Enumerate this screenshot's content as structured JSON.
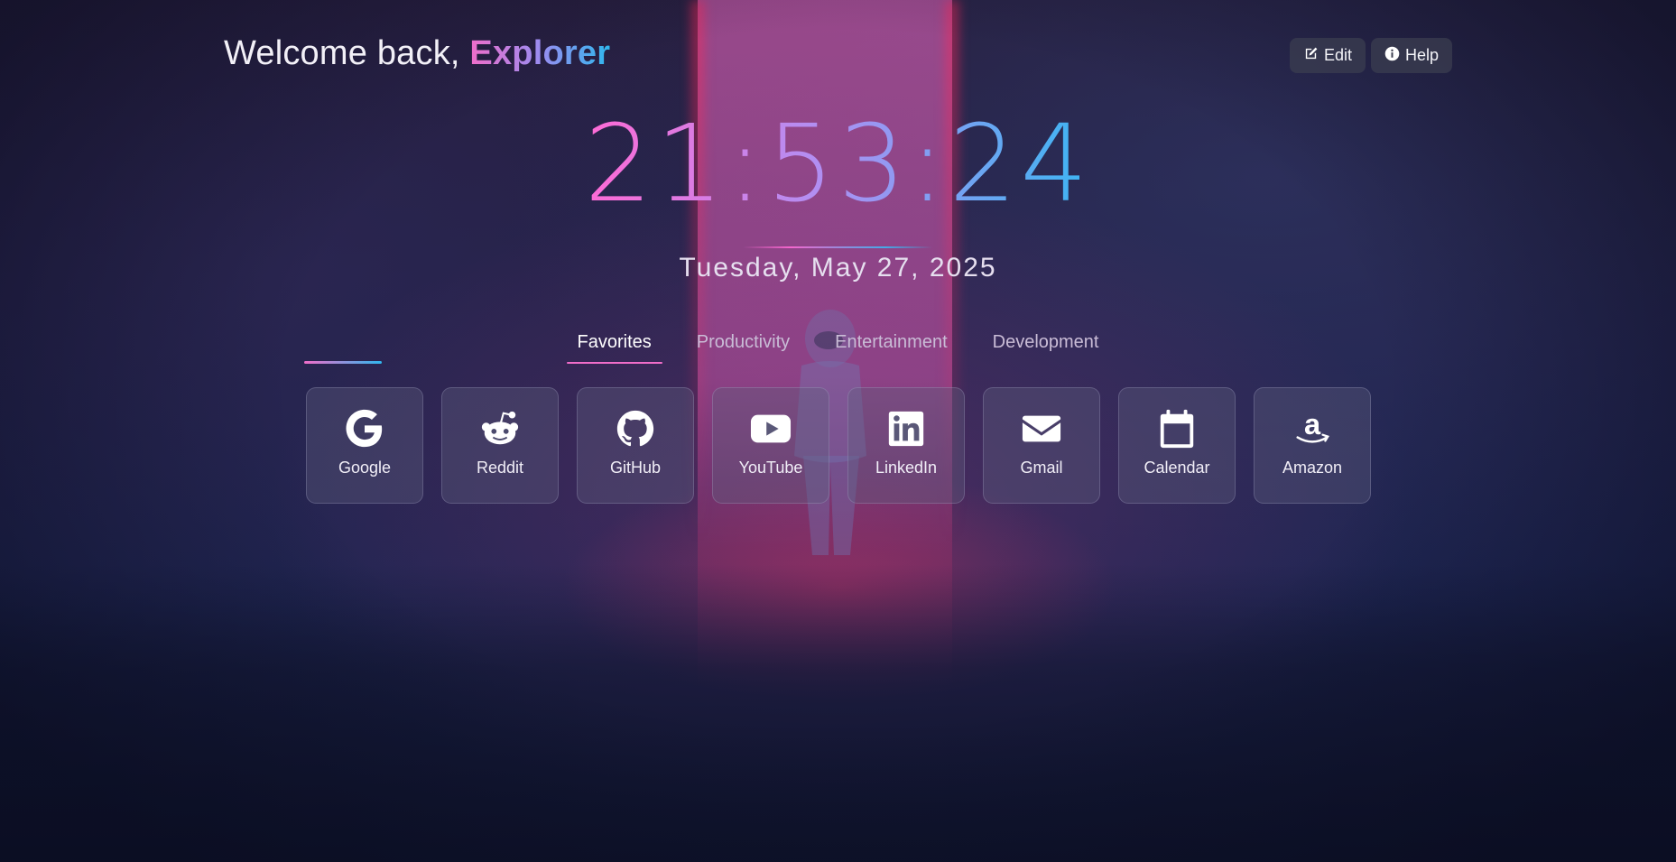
{
  "header": {
    "greeting_prefix": "Welcome back, ",
    "user_name": "Explorer",
    "edit_label": "Edit",
    "help_label": "Help"
  },
  "clock": {
    "time": "21:53:24",
    "date": "Tuesday, May 27, 2025"
  },
  "tabs": [
    {
      "label": "Favorites",
      "active": true
    },
    {
      "label": "Productivity",
      "active": false
    },
    {
      "label": "Entertainment",
      "active": false
    },
    {
      "label": "Development",
      "active": false
    }
  ],
  "shortcuts": [
    {
      "label": "Google",
      "icon": "google-icon"
    },
    {
      "label": "Reddit",
      "icon": "reddit-icon"
    },
    {
      "label": "GitHub",
      "icon": "github-icon"
    },
    {
      "label": "YouTube",
      "icon": "youtube-icon"
    },
    {
      "label": "LinkedIn",
      "icon": "linkedin-icon"
    },
    {
      "label": "Gmail",
      "icon": "envelope-icon"
    },
    {
      "label": "Calendar",
      "icon": "calendar-icon"
    },
    {
      "label": "Amazon",
      "icon": "amazon-icon"
    }
  ],
  "colors": {
    "accent_pink": "#f06dc9",
    "accent_blue": "#2fb7ee",
    "tile_bg": "rgba(95,95,125,0.38)"
  }
}
